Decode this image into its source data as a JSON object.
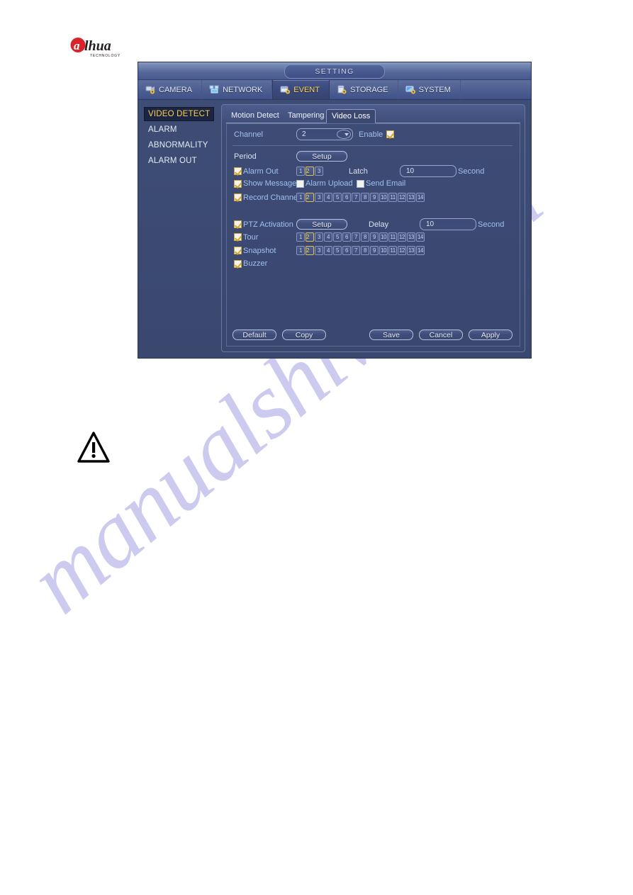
{
  "brand": {
    "logo_text": "alhua",
    "logo_sub": "TECHNOLOGY",
    "logo_accent": "#d8232a"
  },
  "watermark": {
    "text": "manualshive.com",
    "color": "#b9b6e8"
  },
  "dialog": {
    "title": "SETTING",
    "top_tabs": [
      {
        "label": "CAMERA",
        "icon": "camera-gear-icon",
        "active": false
      },
      {
        "label": "NETWORK",
        "icon": "network-icon",
        "active": false
      },
      {
        "label": "EVENT",
        "icon": "event-gear-icon",
        "active": true
      },
      {
        "label": "STORAGE",
        "icon": "storage-gear-icon",
        "active": false
      },
      {
        "label": "SYSTEM",
        "icon": "system-gear-icon",
        "active": false
      }
    ],
    "sidebar": [
      {
        "label": "VIDEO DETECT",
        "active": true
      },
      {
        "label": "ALARM",
        "active": false
      },
      {
        "label": "ABNORMALITY",
        "active": false
      },
      {
        "label": "ALARM OUT",
        "active": false
      }
    ],
    "sub_tabs": [
      {
        "label": "Motion Detect",
        "active": false
      },
      {
        "label": "Tampering",
        "active": false
      },
      {
        "label": "Video Loss",
        "active": true
      }
    ],
    "form": {
      "channel_label": "Channel",
      "channel_value": "2",
      "enable_label": "Enable",
      "enable_checked": true,
      "period_label": "Period",
      "period_button": "Setup",
      "alarm_out_label": "Alarm Out",
      "alarm_out_checked": true,
      "alarm_out_chips": [
        "1",
        "2",
        "3"
      ],
      "alarm_out_selected": [
        "2"
      ],
      "latch_label": "Latch",
      "latch_value": "10",
      "latch_unit": "Second",
      "show_message_label": "Show Message",
      "show_message_checked": true,
      "alarm_upload_label": "Alarm Upload",
      "alarm_upload_checked": false,
      "send_email_label": "Send Email",
      "send_email_checked": false,
      "record_channel_label": "Record Channel",
      "record_channel_checked": true,
      "record_channel_chips": [
        "1",
        "2",
        "3",
        "4",
        "5",
        "6",
        "7",
        "8",
        "9",
        "10",
        "11",
        "12",
        "13",
        "14"
      ],
      "record_channel_selected": [
        "2"
      ],
      "ptz_label": "PTZ Activation",
      "ptz_checked": true,
      "ptz_button": "Setup",
      "delay_label": "Delay",
      "delay_value": "10",
      "delay_unit": "Second",
      "tour_label": "Tour",
      "tour_checked": true,
      "tour_chips": [
        "1",
        "2",
        "3",
        "4",
        "5",
        "6",
        "7",
        "8",
        "9",
        "10",
        "11",
        "12",
        "13",
        "14"
      ],
      "tour_selected": [
        "2"
      ],
      "snapshot_label": "Snapshot",
      "snapshot_checked": true,
      "snapshot_chips": [
        "1",
        "2",
        "3",
        "4",
        "5",
        "6",
        "7",
        "8",
        "9",
        "10",
        "11",
        "12",
        "13",
        "14"
      ],
      "snapshot_selected": [
        "2"
      ],
      "buzzer_label": "Buzzer",
      "buzzer_checked": true
    },
    "footer": {
      "default_label": "Default",
      "copy_label": "Copy",
      "save_label": "Save",
      "cancel_label": "Cancel",
      "apply_label": "Apply"
    }
  }
}
